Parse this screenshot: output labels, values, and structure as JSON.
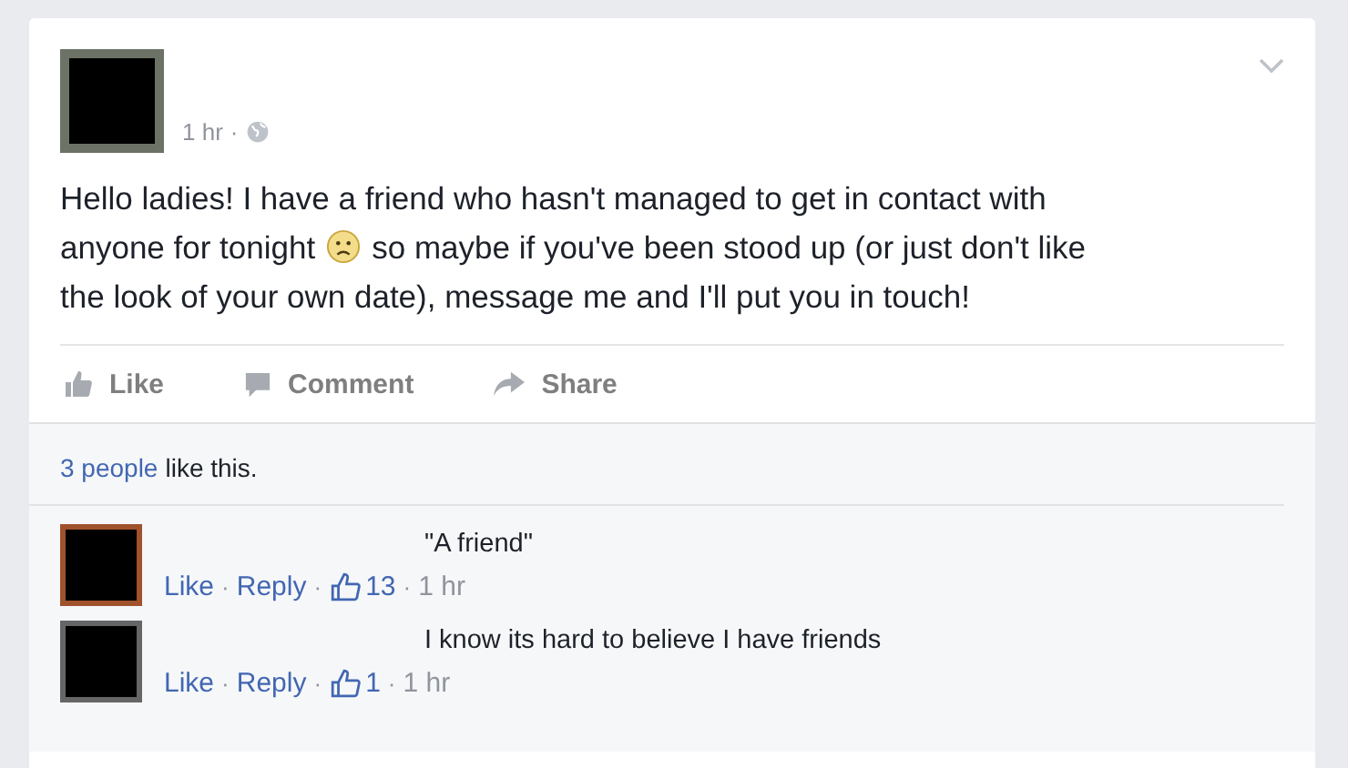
{
  "post": {
    "time": "1 hr",
    "separator": "·",
    "lines": [
      [
        "Hello ladies! I have a friend who hasn't managed to get in contact with"
      ],
      [
        "anyone for tonight",
        "so maybe if you've been stood up (or just don't like"
      ],
      [
        "the look of your own date), message me and I'll put you in touch!"
      ]
    ]
  },
  "actions": [
    {
      "kind": "like",
      "label": "Like"
    },
    {
      "kind": "comment",
      "label": "Comment"
    },
    {
      "kind": "share",
      "label": "Share"
    }
  ],
  "likes": {
    "link": "3 people",
    "rest": "like this."
  },
  "comments": [
    {
      "text": "\"A friend\"",
      "like": "Like",
      "reply": "Reply",
      "count": "13",
      "time": "1 hr",
      "separators": [
        "·",
        "·",
        "·"
      ]
    },
    {
      "text": "I know its hard to believe I have friends",
      "like": "Like",
      "reply": "Reply",
      "count": "1",
      "time": "1 hr",
      "separators": [
        "·",
        "·",
        "·"
      ]
    }
  ]
}
